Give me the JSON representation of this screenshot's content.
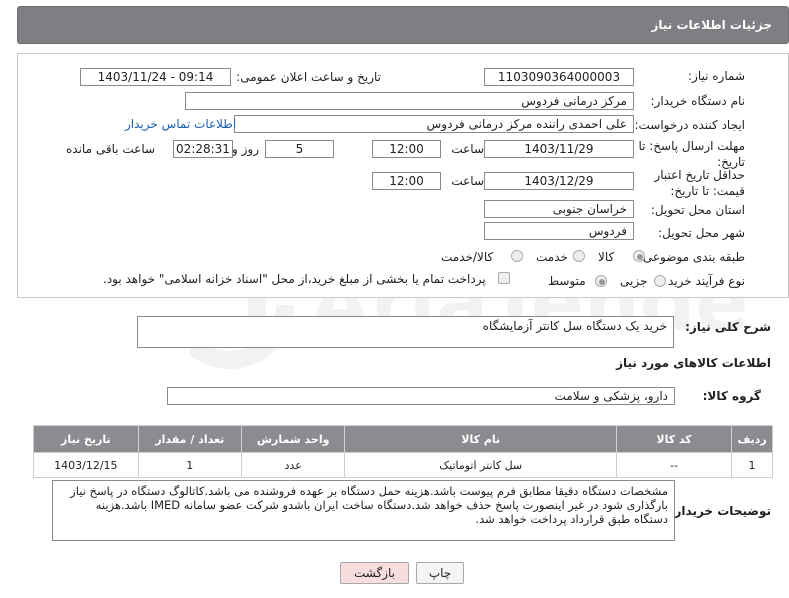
{
  "header": {
    "title": "جزئیات اطلاعات نیاز"
  },
  "fields": {
    "need_number_label": "شماره نیاز:",
    "need_number": "1103090364000003",
    "announce_label": "تاریخ و ساعت اعلان عمومی:",
    "announce_value": "1403/11/24 - 09:14",
    "buyer_org_label": "نام دستگاه خریدار:",
    "buyer_org": "مرکز درمانی فردوس",
    "creator_label": "ایجاد کننده درخواست:",
    "creator": "علی  احمدی راننده  مرکز درمانی فردوس",
    "contact_link": "اطلاعات تماس خریدار",
    "reply_deadline_label": "مهلت ارسال پاسخ: تا تاریخ:",
    "reply_date": "1403/11/29",
    "time_label": "ساعت",
    "reply_time": "12:00",
    "days_value": "5",
    "days_label": "روز و",
    "remaining_time": "02:28:31",
    "remaining_label": "ساعت باقی مانده",
    "price_validity_label": "حداقل تاریخ اعتبار قیمت: تا تاریخ:",
    "price_date": "1403/12/29",
    "price_time": "12:00",
    "province_label": "استان محل تحویل:",
    "province": "خراسان جنوبی",
    "city_label": "شهر محل تحویل:",
    "city": "فردوس",
    "category_label": "طبقه بندی موضوعی:",
    "category_options": [
      "کالا",
      "خدمت",
      "کالا/خدمت"
    ],
    "process_label": "نوع فرآیند خرید :",
    "process_options": [
      "جزیی",
      "متوسط"
    ],
    "payment_note": "پرداخت تمام یا بخشی از مبلغ خرید،از محل \"اسناد خزانه اسلامی\" خواهد بود."
  },
  "description": {
    "label": "شرح کلی نیاز:",
    "value": "خرید یک دستگاه سل کانتر آزمایشگاه"
  },
  "goods_info": {
    "title": "اطلاعات کالاهای مورد نیاز",
    "group_label": "گروه کالا:",
    "group_value": "دارو، پزشکی و سلامت"
  },
  "table": {
    "headers": [
      "ردیف",
      "کد کالا",
      "نام کالا",
      "واحد شمارش",
      "تعداد / مقدار",
      "تاریخ نیاز"
    ],
    "rows": [
      [
        "1",
        "--",
        "سل کانتر اتوماتیک",
        "عدد",
        "1",
        "1403/12/15"
      ]
    ]
  },
  "buyer_notes": {
    "label": "توضیحات خریدار:",
    "value": "مشخصات دستگاه دقیقا مطابق فرم پیوست باشد.هزینه حمل دستگاه بر عهده فروشنده می باشد.کاتالوگ دستگاه در پاسخ نیاز بارگذاری شود در غیر اینصورت پاسخ حذف خواهد شد.دستگاه ساخت ایران باشدو شرکت عضو سامانه IMED باشد.هزینه دستگاه طبق قرارداد پرداخت خواهد شد."
  },
  "buttons": {
    "print": "چاپ",
    "back": "بازگشت"
  },
  "watermark": {
    "text": "AriaTender.neT"
  },
  "colors": {
    "header": "#7d7f82",
    "table_header": "#8a8c8f",
    "back_button": "#f7dede",
    "link": "#1a5fb4"
  }
}
